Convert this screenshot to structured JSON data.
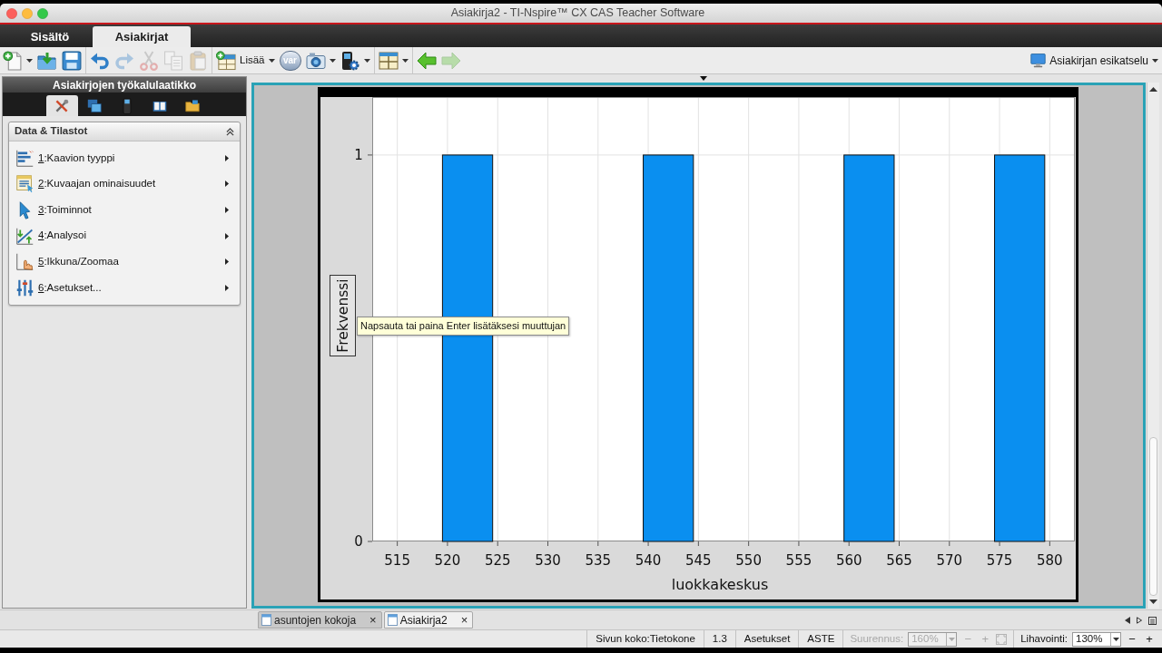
{
  "window": {
    "title": "Asiakirja2 - TI-Nspire™ CX CAS Teacher Software"
  },
  "main_tabs": [
    {
      "label": "Sisältö",
      "selected": false
    },
    {
      "label": "Asiakirjat",
      "selected": true
    }
  ],
  "toolbar": {
    "groups": [
      [
        {
          "kind": "icon",
          "menu": true,
          "disabled": false
        },
        {
          "kind": "icon",
          "menu": false,
          "disabled": false
        },
        {
          "kind": "icon",
          "menu": false,
          "disabled": false
        }
      ],
      [
        {
          "kind": "icon",
          "menu": false,
          "disabled": false
        },
        {
          "kind": "icon",
          "menu": false,
          "disabled": true
        },
        {
          "kind": "icon",
          "menu": false,
          "disabled": true
        },
        {
          "kind": "icon",
          "menu": false,
          "disabled": true
        },
        {
          "kind": "icon",
          "menu": false,
          "disabled": true
        }
      ],
      [
        {
          "kind": "icon_label",
          "label": "Lisää",
          "menu": true,
          "disabled": false
        },
        {
          "kind": "text_icon",
          "label": "var",
          "menu": false,
          "disabled": false
        },
        {
          "kind": "icon",
          "menu": true,
          "disabled": false
        },
        {
          "kind": "icon",
          "menu": true,
          "disabled": false
        }
      ],
      [
        {
          "kind": "icon",
          "menu": true,
          "disabled": false
        }
      ],
      [
        {
          "kind": "icon",
          "menu": false,
          "disabled": false
        },
        {
          "kind": "icon",
          "menu": false,
          "disabled": true
        }
      ]
    ],
    "preview": {
      "label": "Asiakirjan esikatselu",
      "menu": true
    }
  },
  "toolbox": {
    "title": "Asiakirjojen työkalulaatikko",
    "tabs": [
      {
        "selected": true
      },
      {
        "selected": false
      },
      {
        "selected": false
      },
      {
        "selected": false
      },
      {
        "selected": false
      }
    ],
    "section": {
      "title": "Data & Tilastot",
      "expanded": true,
      "items": [
        {
          "label": "1:Kaavion tyyppi",
          "submenu": true
        },
        {
          "label": "2:Kuvaajan ominaisuudet",
          "submenu": true
        },
        {
          "label": "3:Toiminnot",
          "submenu": true
        },
        {
          "label": "4:Analysoi",
          "submenu": true
        },
        {
          "label": "5:Ikkuna/Zoomaa",
          "submenu": true
        },
        {
          "label": "6:Asetukset...",
          "submenu": true
        }
      ]
    }
  },
  "document": {
    "chart_data": [
      {
        "type": "bar",
        "xlabel": "luokkakeskus",
        "ylabel": "Frekvenssi",
        "x": [
          522,
          542,
          562,
          577
        ],
        "values": [
          1,
          1,
          1,
          1
        ],
        "color": "#0a8ff0",
        "xlim": [
          512.5,
          582.5
        ],
        "ylim": [
          0,
          1.15
        ],
        "xticks": [
          515,
          520,
          525,
          530,
          535,
          540,
          545,
          550,
          555,
          560,
          565,
          570,
          575,
          580
        ],
        "yticks": [
          0,
          1
        ],
        "grid": true
      }
    ],
    "tooltip": "Napsauta tai paina Enter lisätäksesi muuttujan"
  },
  "page_tabs": [
    {
      "label": "asuntojen kokoja",
      "close": "×",
      "selected": false
    },
    {
      "label": "Asiakirja2",
      "close": "×",
      "selected": true
    }
  ],
  "status_bar": {
    "items": [
      {
        "kind": "text",
        "label": "Sivun koko:Tietokone"
      },
      {
        "kind": "text",
        "label": "1.3"
      },
      {
        "kind": "text",
        "label": "Asetukset"
      },
      {
        "kind": "text",
        "label": "ASTE"
      },
      {
        "kind": "zoom",
        "label": "Suurennus:",
        "value": "160%",
        "minus": "−",
        "plus": "+",
        "disabled": true
      },
      {
        "kind": "font_size",
        "label": "Lihavointi:",
        "value": "130%",
        "minus": "−",
        "plus": "+",
        "disabled": false
      }
    ]
  }
}
